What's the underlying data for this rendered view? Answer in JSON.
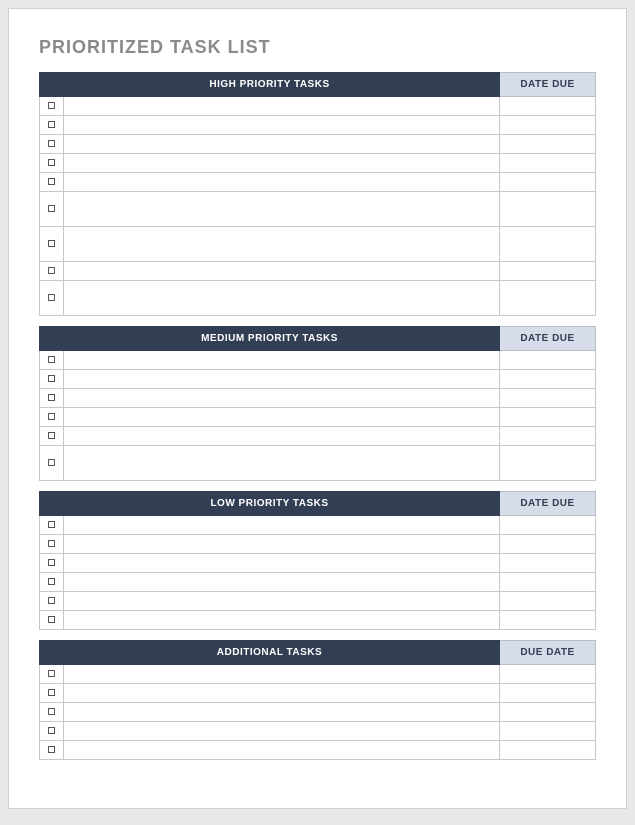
{
  "title": "PRIORITIZED TASK LIST",
  "sections": [
    {
      "task_header": "HIGH PRIORITY TASKS",
      "due_header": "DATE DUE",
      "rows": [
        {
          "checked": false,
          "task": "",
          "due": "",
          "tall": false
        },
        {
          "checked": false,
          "task": "",
          "due": "",
          "tall": false
        },
        {
          "checked": false,
          "task": "",
          "due": "",
          "tall": false
        },
        {
          "checked": false,
          "task": "",
          "due": "",
          "tall": false
        },
        {
          "checked": false,
          "task": "",
          "due": "",
          "tall": false
        },
        {
          "checked": false,
          "task": "",
          "due": "",
          "tall": true
        },
        {
          "checked": false,
          "task": "",
          "due": "",
          "tall": true
        },
        {
          "checked": false,
          "task": "",
          "due": "",
          "tall": false
        },
        {
          "checked": false,
          "task": "",
          "due": "",
          "tall": true
        }
      ]
    },
    {
      "task_header": "MEDIUM PRIORITY TASKS",
      "due_header": "DATE DUE",
      "rows": [
        {
          "checked": false,
          "task": "",
          "due": "",
          "tall": false
        },
        {
          "checked": false,
          "task": "",
          "due": "",
          "tall": false
        },
        {
          "checked": false,
          "task": "",
          "due": "",
          "tall": false
        },
        {
          "checked": false,
          "task": "",
          "due": "",
          "tall": false
        },
        {
          "checked": false,
          "task": "",
          "due": "",
          "tall": false
        },
        {
          "checked": false,
          "task": "",
          "due": "",
          "tall": true
        }
      ]
    },
    {
      "task_header": "LOW PRIORITY TASKS",
      "due_header": "DATE DUE",
      "rows": [
        {
          "checked": false,
          "task": "",
          "due": "",
          "tall": false
        },
        {
          "checked": false,
          "task": "",
          "due": "",
          "tall": false
        },
        {
          "checked": false,
          "task": "",
          "due": "",
          "tall": false
        },
        {
          "checked": false,
          "task": "",
          "due": "",
          "tall": false
        },
        {
          "checked": false,
          "task": "",
          "due": "",
          "tall": false
        },
        {
          "checked": false,
          "task": "",
          "due": "",
          "tall": false
        }
      ]
    },
    {
      "task_header": "ADDITIONAL TASKS",
      "due_header": "DUE DATE",
      "rows": [
        {
          "checked": false,
          "task": "",
          "due": "",
          "tall": false
        },
        {
          "checked": false,
          "task": "",
          "due": "",
          "tall": false
        },
        {
          "checked": false,
          "task": "",
          "due": "",
          "tall": false
        },
        {
          "checked": false,
          "task": "",
          "due": "",
          "tall": false
        },
        {
          "checked": false,
          "task": "",
          "due": "",
          "tall": false
        }
      ]
    }
  ]
}
